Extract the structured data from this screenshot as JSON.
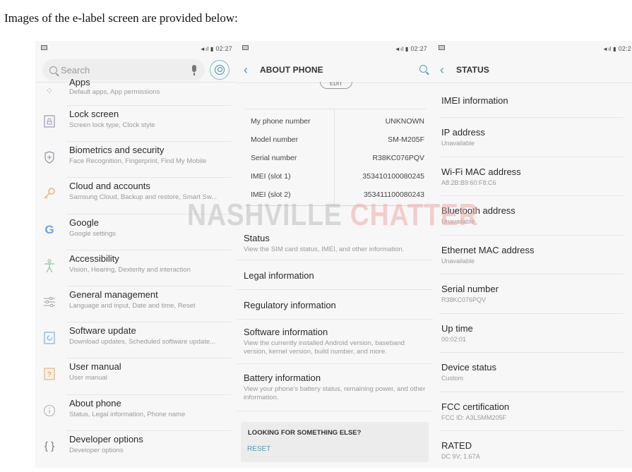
{
  "intro_text": "Images of the e-label screen are provided below:",
  "watermark": {
    "part1": "NASHVILLE",
    "part2": "CHATTER"
  },
  "status_bar": {
    "time_full": "02:27",
    "time_cut": "02:2"
  },
  "settings_screen": {
    "search_placeholder": "Search",
    "items": [
      {
        "title": "Apps",
        "subtitle": "Default apps, App permissions",
        "icon": "apps-icon"
      },
      {
        "title": "Lock screen",
        "subtitle": "Screen lock type, Clock style",
        "icon": "lock-icon"
      },
      {
        "title": "Biometrics and security",
        "subtitle": "Face Recognition, Fingerprint, Find My Mobile",
        "icon": "shield-icon"
      },
      {
        "title": "Cloud and accounts",
        "subtitle": "Samsung Cloud, Backup and restore, Smart Sw...",
        "icon": "key-icon"
      },
      {
        "title": "Google",
        "subtitle": "Google settings",
        "icon": "google-icon"
      },
      {
        "title": "Accessibility",
        "subtitle": "Vision, Hearing, Dexterity and interaction",
        "icon": "accessibility-icon"
      },
      {
        "title": "General management",
        "subtitle": "Language and input, Date and time, Reset",
        "icon": "sliders-icon"
      },
      {
        "title": "Software update",
        "subtitle": "Download updates, Scheduled software update...",
        "icon": "update-icon"
      },
      {
        "title": "User manual",
        "subtitle": "User manual",
        "icon": "help-icon"
      },
      {
        "title": "About phone",
        "subtitle": "Status, Legal information, Phone name",
        "icon": "info-icon"
      },
      {
        "title": "Developer options",
        "subtitle": "Developer options",
        "icon": "braces-icon"
      }
    ]
  },
  "about_screen": {
    "title": "ABOUT PHONE",
    "edit_label": "EDIT",
    "info": [
      {
        "key": "My phone number",
        "value": "UNKNOWN"
      },
      {
        "key": "Model number",
        "value": "SM-M205F"
      },
      {
        "key": "Serial number",
        "value": "R38KC076PQV"
      },
      {
        "key": "IMEI (slot 1)",
        "value": "353410100080245"
      },
      {
        "key": "IMEI (slot 2)",
        "value": "353411100080243"
      }
    ],
    "items": [
      {
        "title": "Status",
        "subtitle": "View the SIM card status, IMEI, and other information."
      },
      {
        "title": "Legal information",
        "subtitle": ""
      },
      {
        "title": "Regulatory information",
        "subtitle": ""
      },
      {
        "title": "Software information",
        "subtitle": "View the currently installed Android version, baseband version, kernel version, build number, and more."
      },
      {
        "title": "Battery information",
        "subtitle": "View your phone's battery status, remaining power, and other information."
      }
    ],
    "looking_for": "LOOKING FOR SOMETHING ELSE?",
    "reset_label": "RESET"
  },
  "status_screen": {
    "title": "STATUS",
    "items": [
      {
        "title": "IMEI information",
        "subtitle": ""
      },
      {
        "title": "IP address",
        "subtitle": "Unavailable"
      },
      {
        "title": "Wi-Fi MAC address",
        "subtitle": "A8:2B:B9:60:F8:C6"
      },
      {
        "title": "Bluetooth address",
        "subtitle": "Unavailable"
      },
      {
        "title": "Ethernet MAC address",
        "subtitle": "Unavailable"
      },
      {
        "title": "Serial number",
        "subtitle": "R38KC076PQV"
      },
      {
        "title": "Up time",
        "subtitle": "00:02:01"
      },
      {
        "title": "Device status",
        "subtitle": "Custom"
      },
      {
        "title": "FCC certification",
        "subtitle": "FCC ID: A3LSMM205F"
      },
      {
        "title": "RATED",
        "subtitle": "DC 9V; 1.67A"
      }
    ]
  }
}
